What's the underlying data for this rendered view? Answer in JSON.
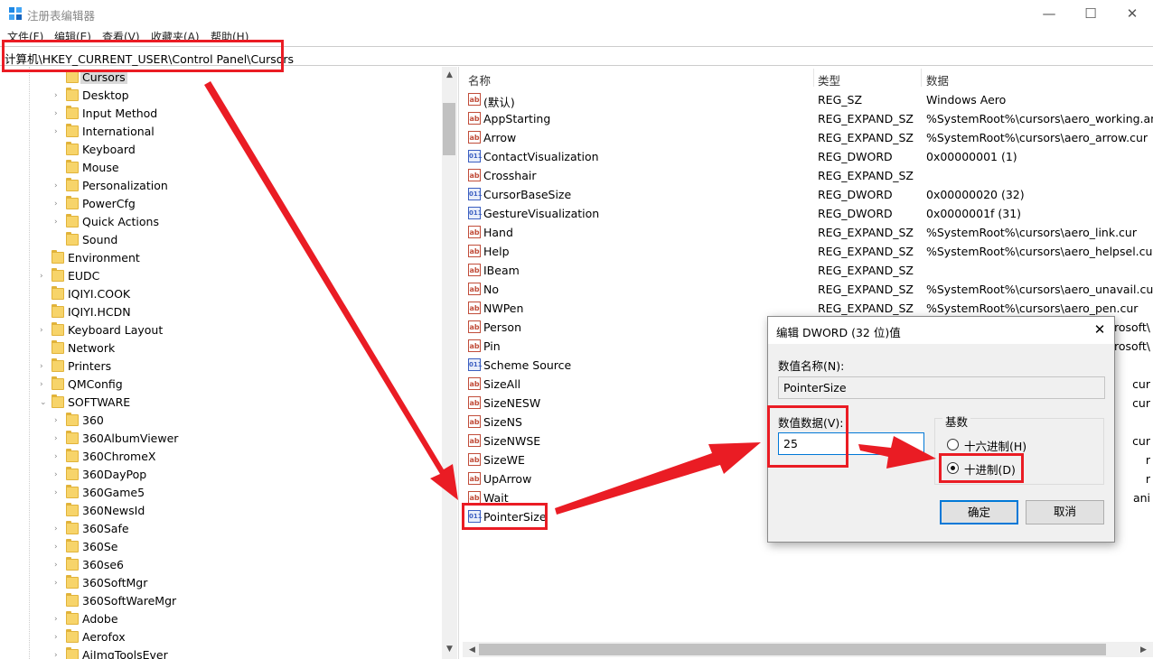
{
  "window": {
    "title": "注册表编辑器",
    "minimize": "—",
    "maximize": "☐",
    "close": "✕"
  },
  "menu": [
    "文件(F)",
    "编辑(E)",
    "查看(V)",
    "收藏夹(A)",
    "帮助(H)"
  ],
  "address": "计算机\\HKEY_CURRENT_USER\\Control Panel\\Cursors",
  "tree": {
    "items": [
      {
        "label": "Cursors",
        "level": 2,
        "expander": false,
        "selected": true
      },
      {
        "label": "Desktop",
        "level": 2,
        "expander": true
      },
      {
        "label": "Input Method",
        "level": 2,
        "expander": true
      },
      {
        "label": "International",
        "level": 2,
        "expander": true
      },
      {
        "label": "Keyboard",
        "level": 2,
        "expander": false
      },
      {
        "label": "Mouse",
        "level": 2,
        "expander": false
      },
      {
        "label": "Personalization",
        "level": 2,
        "expander": true
      },
      {
        "label": "PowerCfg",
        "level": 2,
        "expander": true
      },
      {
        "label": "Quick Actions",
        "level": 2,
        "expander": true
      },
      {
        "label": "Sound",
        "level": 2,
        "expander": false
      },
      {
        "label": "Environment",
        "level": 1,
        "expander": false
      },
      {
        "label": "EUDC",
        "level": 1,
        "expander": true
      },
      {
        "label": "IQIYI.COOK",
        "level": 1,
        "expander": false
      },
      {
        "label": "IQIYI.HCDN",
        "level": 1,
        "expander": false
      },
      {
        "label": "Keyboard Layout",
        "level": 1,
        "expander": true
      },
      {
        "label": "Network",
        "level": 1,
        "expander": false
      },
      {
        "label": "Printers",
        "level": 1,
        "expander": true
      },
      {
        "label": "QMConfig",
        "level": 1,
        "expander": true
      },
      {
        "label": "SOFTWARE",
        "level": 1,
        "expander": true,
        "expanded": true
      },
      {
        "label": "360",
        "level": 2,
        "expander": true
      },
      {
        "label": "360AlbumViewer",
        "level": 2,
        "expander": true
      },
      {
        "label": "360ChromeX",
        "level": 2,
        "expander": true
      },
      {
        "label": "360DayPop",
        "level": 2,
        "expander": true
      },
      {
        "label": "360Game5",
        "level": 2,
        "expander": true
      },
      {
        "label": "360NewsId",
        "level": 2,
        "expander": false
      },
      {
        "label": "360Safe",
        "level": 2,
        "expander": true
      },
      {
        "label": "360Se",
        "level": 2,
        "expander": true
      },
      {
        "label": "360se6",
        "level": 2,
        "expander": true
      },
      {
        "label": "360SoftMgr",
        "level": 2,
        "expander": true
      },
      {
        "label": "360SoftWareMgr",
        "level": 2,
        "expander": false
      },
      {
        "label": "Adobe",
        "level": 2,
        "expander": true
      },
      {
        "label": "Aerofox",
        "level": 2,
        "expander": true
      },
      {
        "label": "AiImgToolsEver",
        "level": 2,
        "expander": true
      }
    ]
  },
  "list": {
    "headers": {
      "name": "名称",
      "type": "类型",
      "data": "数据"
    },
    "rows": [
      {
        "name": "(默认)",
        "type": "REG_SZ",
        "data": "Windows Aero",
        "icon": "sz"
      },
      {
        "name": "AppStarting",
        "type": "REG_EXPAND_SZ",
        "data": "%SystemRoot%\\cursors\\aero_working.ani",
        "icon": "sz"
      },
      {
        "name": "Arrow",
        "type": "REG_EXPAND_SZ",
        "data": "%SystemRoot%\\cursors\\aero_arrow.cur",
        "icon": "sz"
      },
      {
        "name": "ContactVisualization",
        "type": "REG_DWORD",
        "data": "0x00000001 (1)",
        "icon": "bin"
      },
      {
        "name": "Crosshair",
        "type": "REG_EXPAND_SZ",
        "data": "",
        "icon": "sz"
      },
      {
        "name": "CursorBaseSize",
        "type": "REG_DWORD",
        "data": "0x00000020 (32)",
        "icon": "bin"
      },
      {
        "name": "GestureVisualization",
        "type": "REG_DWORD",
        "data": "0x0000001f (31)",
        "icon": "bin"
      },
      {
        "name": "Hand",
        "type": "REG_EXPAND_SZ",
        "data": "%SystemRoot%\\cursors\\aero_link.cur",
        "icon": "sz"
      },
      {
        "name": "Help",
        "type": "REG_EXPAND_SZ",
        "data": "%SystemRoot%\\cursors\\aero_helpsel.cur",
        "icon": "sz"
      },
      {
        "name": "IBeam",
        "type": "REG_EXPAND_SZ",
        "data": "",
        "icon": "sz"
      },
      {
        "name": "No",
        "type": "REG_EXPAND_SZ",
        "data": "%SystemRoot%\\cursors\\aero_unavail.cur",
        "icon": "sz"
      },
      {
        "name": "NWPen",
        "type": "REG_EXPAND_SZ",
        "data": "%SystemRoot%\\cursors\\aero_pen.cur",
        "icon": "sz"
      },
      {
        "name": "Person",
        "type": "",
        "data": "rosoft\\",
        "icon": "sz"
      },
      {
        "name": "Pin",
        "type": "",
        "data": "rosoft\\",
        "icon": "sz"
      },
      {
        "name": "Scheme Source",
        "type": "",
        "data": "",
        "icon": "bin"
      },
      {
        "name": "SizeAll",
        "type": "",
        "data": "cur",
        "icon": "sz"
      },
      {
        "name": "SizeNESW",
        "type": "",
        "data": "cur",
        "icon": "sz"
      },
      {
        "name": "SizeNS",
        "type": "",
        "data": "",
        "icon": "sz"
      },
      {
        "name": "SizeNWSE",
        "type": "",
        "data": "cur",
        "icon": "sz"
      },
      {
        "name": "SizeWE",
        "type": "",
        "data": "r",
        "icon": "sz"
      },
      {
        "name": "UpArrow",
        "type": "",
        "data": "r",
        "icon": "sz"
      },
      {
        "name": "Wait",
        "type": "",
        "data": "ani",
        "icon": "sz"
      },
      {
        "name": "PointerSize",
        "type": "",
        "data": "",
        "icon": "bin"
      }
    ]
  },
  "dialog": {
    "title": "编辑 DWORD (32 位)值",
    "close": "✕",
    "name_label": "数值名称(N):",
    "name_value": "PointerSize",
    "data_label": "数值数据(V):",
    "data_value": "25",
    "base_label": "基数",
    "hex_label": "十六进制(H)",
    "dec_label": "十进制(D)",
    "selected_base": "decimal",
    "ok": "确定",
    "cancel": "取消"
  },
  "colors": {
    "highlight": "#ea1c24",
    "accent": "#0078d7"
  }
}
